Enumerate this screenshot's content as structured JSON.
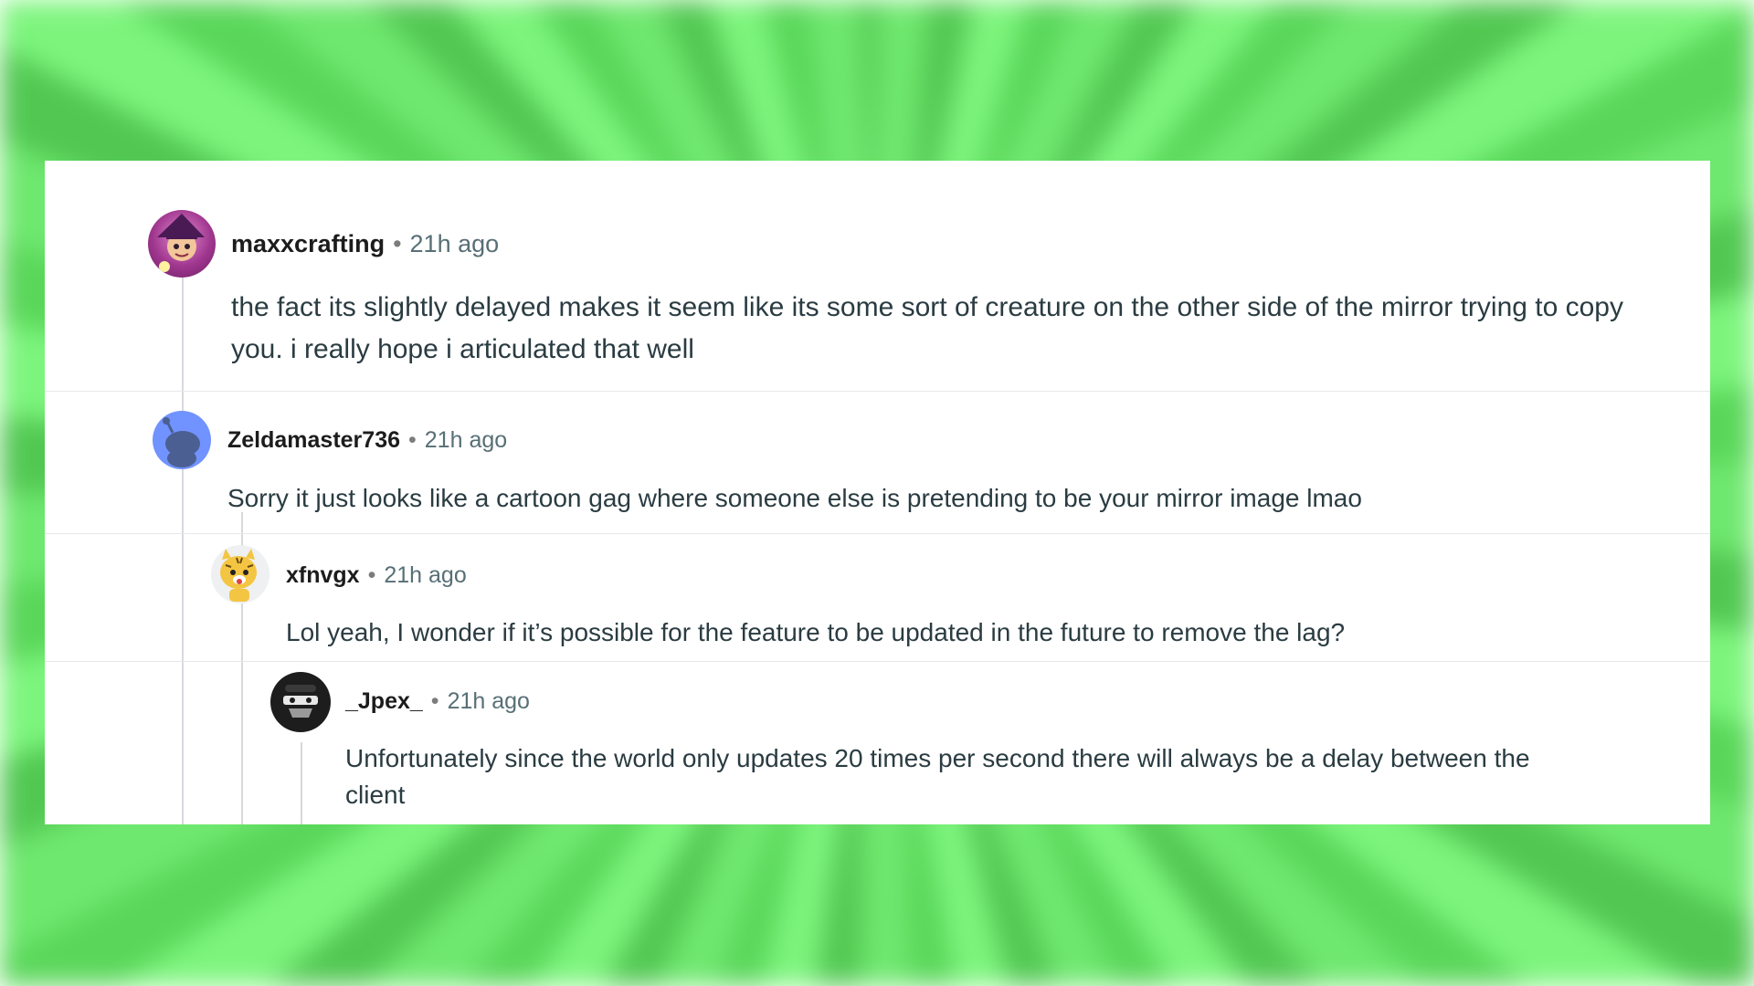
{
  "comments": [
    {
      "username": "maxxcrafting",
      "separator": "•",
      "time": "21h ago",
      "text": "the fact its slightly delayed makes it seem like its some sort of creature on the other side of the mirror trying to copy you. i really hope i articulated that well",
      "avatar_icon": "witch-character-avatar-icon"
    },
    {
      "username": "Zeldamaster736",
      "separator": "•",
      "time": "21h ago",
      "text": "Sorry it just looks like a cartoon gag where someone else is pretending to be your mirror image lmao",
      "avatar_icon": "default-snoo-avatar-icon"
    },
    {
      "username": "xfnvgx",
      "separator": "•",
      "time": "21h ago",
      "text": "Lol yeah, I wonder if it’s possible for the feature to be updated in the future to remove the lag?",
      "avatar_icon": "tiger-avatar-icon"
    },
    {
      "username": "_Jpex_",
      "separator": "•",
      "time": "21h ago",
      "text": "Unfortunately since the world only updates 20 times per second there will always be a delay between the client",
      "avatar_icon": "bandit-mask-avatar-icon"
    }
  ],
  "colors": {
    "background_green": "#6fe86f",
    "card": "#ffffff",
    "thread_line": "#d6d9dc",
    "username": "#1c1c1c",
    "timestamp": "#576f76",
    "body": "#2a3c42"
  }
}
